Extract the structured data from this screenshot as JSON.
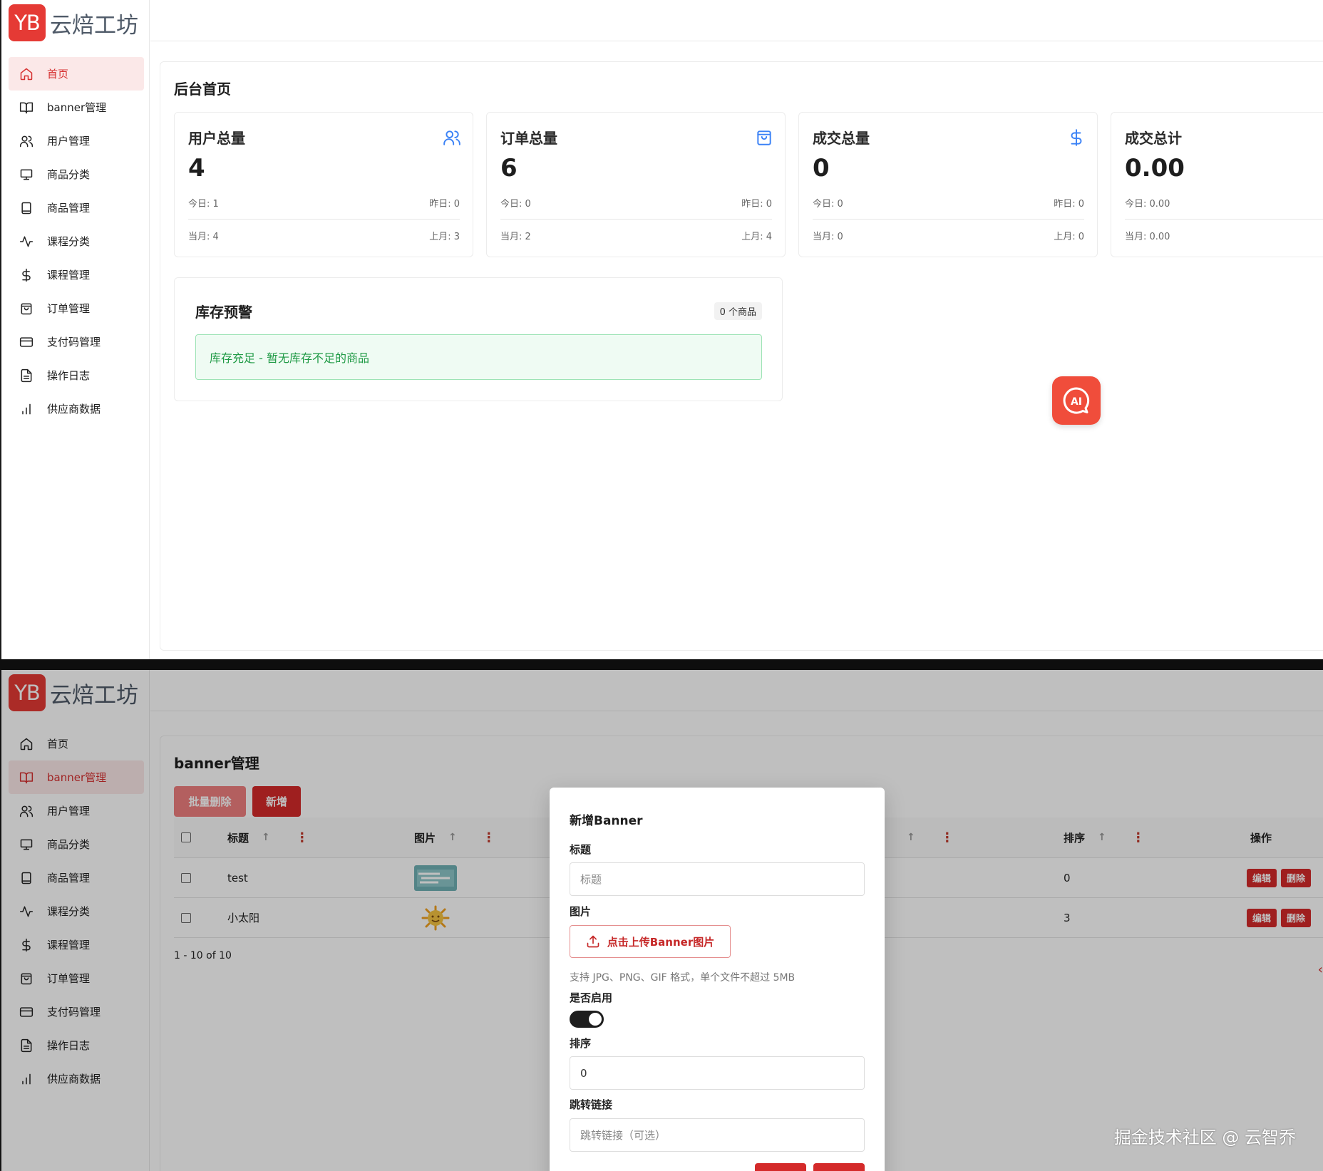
{
  "brand": {
    "logo": "YB",
    "name": "云焙工坊"
  },
  "nav": [
    {
      "label": "首页",
      "icon": "home-icon"
    },
    {
      "label": "banner管理",
      "icon": "book-icon"
    },
    {
      "label": "用户管理",
      "icon": "users-icon"
    },
    {
      "label": "商品分类",
      "icon": "monitor-icon"
    },
    {
      "label": "商品管理",
      "icon": "tablet-icon"
    },
    {
      "label": "课程分类",
      "icon": "activity-icon"
    },
    {
      "label": "课程管理",
      "icon": "dollar-icon"
    },
    {
      "label": "订单管理",
      "icon": "shopping-bag-icon"
    },
    {
      "label": "支付码管理",
      "icon": "credit-card-icon"
    },
    {
      "label": "操作日志",
      "icon": "file-text-icon"
    },
    {
      "label": "供应商数据",
      "icon": "bar-chart-icon"
    }
  ],
  "dashboard": {
    "title": "后台首页",
    "stats": [
      {
        "label": "用户总量",
        "value": "4",
        "today": "今日: 1",
        "yesterday": "昨日: 0",
        "month": "当月: 4",
        "last_month": "上月: 3",
        "icon": "users-icon"
      },
      {
        "label": "订单总量",
        "value": "6",
        "today": "今日: 0",
        "yesterday": "昨日: 0",
        "month": "当月: 2",
        "last_month": "上月: 4",
        "icon": "shopping-bag-icon"
      },
      {
        "label": "成交总量",
        "value": "0",
        "today": "今日: 0",
        "yesterday": "昨日: 0",
        "month": "当月: 0",
        "last_month": "上月: 0",
        "icon": "dollar-icon"
      },
      {
        "label": "成交总计",
        "value": "0.00",
        "today": "今日: 0.00",
        "yesterday": "",
        "month": "当月: 0.00",
        "last_month": "",
        "icon": ""
      }
    ],
    "stock": {
      "title": "库存预警",
      "badge": "0 个商品",
      "message": "库存充足 - 暂无库存不足的商品"
    },
    "ai_button": "AI"
  },
  "banner_page": {
    "title": "banner管理",
    "batch_delete": "批量删除",
    "add": "新增",
    "columns": {
      "title": "标题",
      "image": "图片",
      "order": "排序",
      "actions": "操作"
    },
    "rows": [
      {
        "title": "test",
        "order": "0",
        "edit": "编辑",
        "delete": "删除"
      },
      {
        "title": "小太阳",
        "order": "3",
        "edit": "编辑",
        "delete": "删除"
      }
    ],
    "pagination": "1 - 10 of 10"
  },
  "modal": {
    "title": "新增Banner",
    "title_label": "标题",
    "title_placeholder": "标题",
    "image_label": "图片",
    "upload_label": "点击上传Banner图片",
    "upload_hint": "支持 JPG、PNG、GIF 格式，单个文件不超过 5MB",
    "enabled_label": "是否启用",
    "enabled": true,
    "order_label": "排序",
    "order_value": "0",
    "link_label": "跳转链接",
    "link_placeholder": "跳转链接（可选）"
  },
  "watermark": "掘金技术社区 @ 云智乔",
  "colors": {
    "brand": "#e53a35",
    "accent_blue": "#3b82f6",
    "success_green": "#1f9a45"
  }
}
